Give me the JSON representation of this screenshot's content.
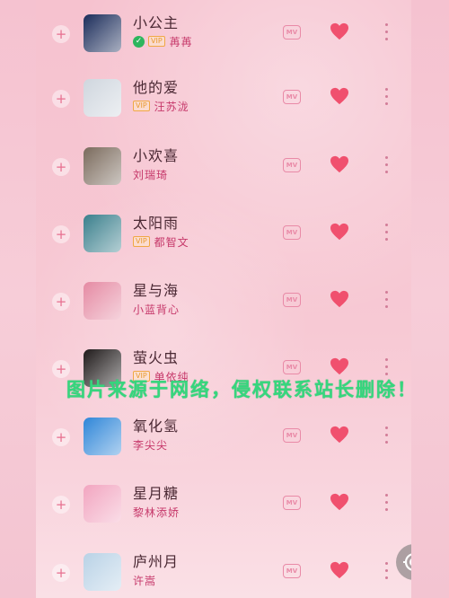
{
  "songs": [
    {
      "title": "小公主",
      "artist": "苒苒",
      "vip": "VIP",
      "verified": true,
      "cover_color": "#1b2c5a"
    },
    {
      "title": "他的爱",
      "artist": "汪苏泷",
      "vip": "VIP",
      "verified": false,
      "cover_color": "#cfd6de"
    },
    {
      "title": "小欢喜",
      "artist": "刘瑞琦",
      "vip": "",
      "verified": false,
      "cover_color": "#7a6a5c"
    },
    {
      "title": "太阳雨",
      "artist": "都智文",
      "vip": "VIP",
      "verified": false,
      "cover_color": "#3a7f8c"
    },
    {
      "title": "星与海",
      "artist": "小蓝背心",
      "vip": "",
      "verified": false,
      "cover_color": "#e58aa3"
    },
    {
      "title": "萤火虫",
      "artist": "单依纯",
      "vip": "VIP",
      "verified": false,
      "cover_color": "#1f1a1a"
    },
    {
      "title": "氧化氢",
      "artist": "李尖尖",
      "vip": "",
      "verified": false,
      "cover_color": "#2f86d8"
    },
    {
      "title": "星月糖",
      "artist": "黎林添娇",
      "vip": "",
      "verified": false,
      "cover_color": "#f2a5c0"
    },
    {
      "title": "庐州月",
      "artist": "许嵩",
      "vip": "",
      "verified": false,
      "cover_color": "#b9d2e6"
    }
  ],
  "mv_label": "MV",
  "add_label": "+",
  "check_glyph": "✓",
  "watermark": "图片来源于网络，侵权联系站长删除！",
  "colors": {
    "heart": "#f0506e",
    "artist": "#c6386a",
    "watermark": "#36d67d"
  }
}
